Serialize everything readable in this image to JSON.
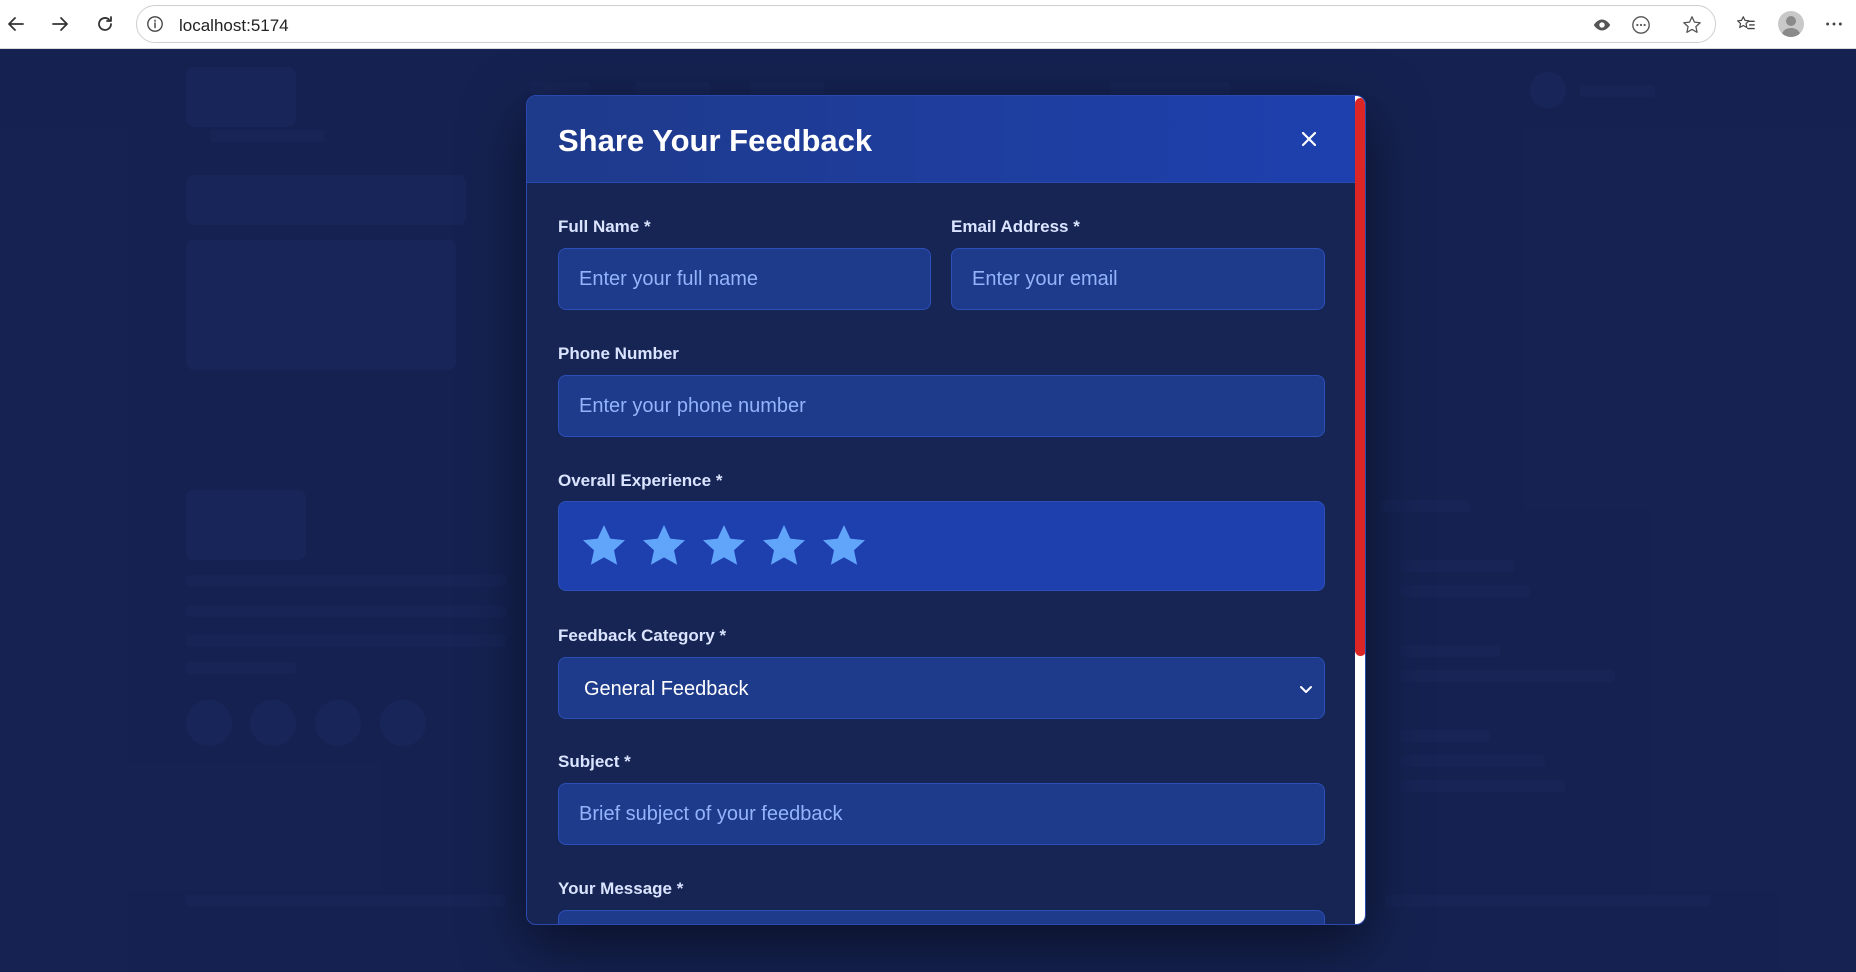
{
  "browser": {
    "url": "localhost:5174"
  },
  "modal": {
    "title": "Share Your Feedback",
    "fields": {
      "full_name": {
        "label": "Full Name *",
        "placeholder": "Enter your full name",
        "value": ""
      },
      "email": {
        "label": "Email Address *",
        "placeholder": "Enter your email",
        "value": ""
      },
      "phone": {
        "label": "Phone Number",
        "placeholder": "Enter your phone number",
        "value": ""
      },
      "experience": {
        "label": "Overall Experience *",
        "stars_total": 5,
        "star_color": "#60a5fa"
      },
      "category": {
        "label": "Feedback Category *",
        "selected": "General Feedback"
      },
      "subject": {
        "label": "Subject *",
        "placeholder": "Brief subject of your feedback",
        "value": ""
      },
      "message": {
        "label": "Your Message *"
      }
    }
  },
  "colors": {
    "accent": "#1e40af",
    "scrollbar_thumb": "#dc2626",
    "page_background": "#172554"
  }
}
